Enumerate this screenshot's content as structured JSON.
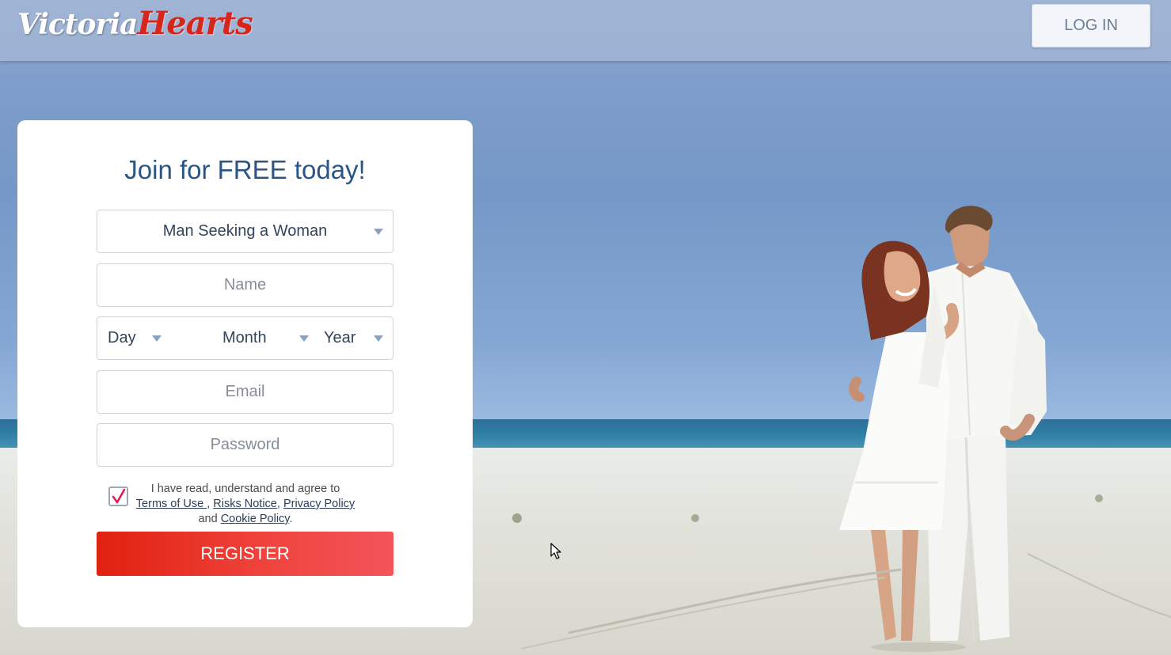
{
  "brand": {
    "logo_word1": "Victoria",
    "logo_word2": "Hearts"
  },
  "header": {
    "login_label": "LOG IN"
  },
  "signup": {
    "title": "Join for FREE today!",
    "seeking": {
      "value": "Man Seeking a Woman"
    },
    "name": {
      "placeholder": "Name"
    },
    "dob": {
      "day": "Day",
      "month": "Month",
      "year": "Year"
    },
    "email": {
      "placeholder": "Email"
    },
    "password": {
      "placeholder": "Password"
    },
    "consent": {
      "checked": true,
      "text_before": "I have read, understand and agree to",
      "terms": "Terms of Use ",
      "sep1": ", ",
      "risks": "Risks Notice",
      "sep2": ", ",
      "privacy": "Privacy Policy",
      "and": "and ",
      "cookie": "Cookie Policy",
      "period": "."
    },
    "register_label": "REGISTER"
  },
  "colors": {
    "title": "#2a5586",
    "register_start": "#e0210f",
    "register_end": "#f3545a",
    "checkmark": "#e0195a"
  }
}
